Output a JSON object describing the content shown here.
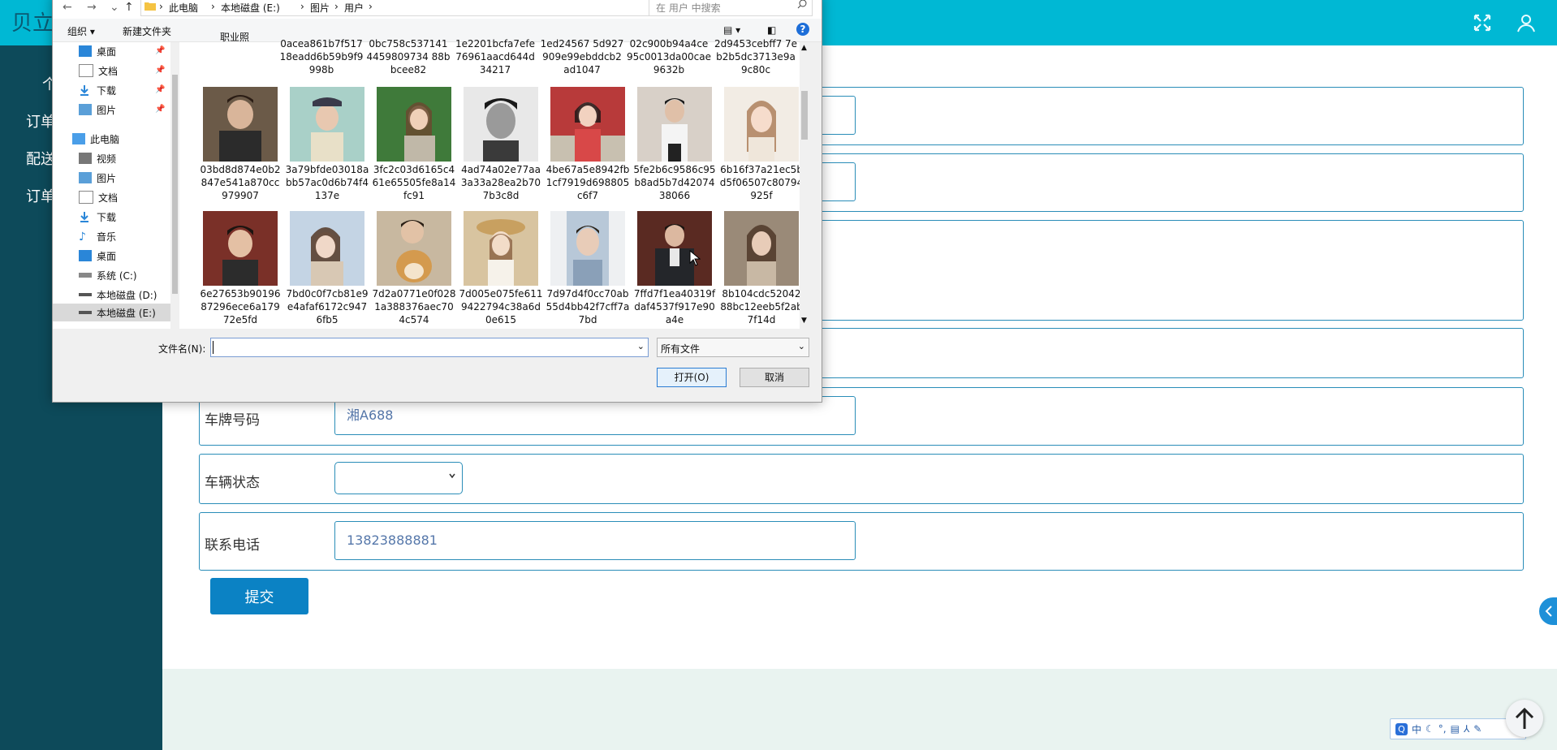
{
  "app": {
    "brand": "贝立",
    "sidebar": [
      "个",
      "订单",
      "配送",
      "订单"
    ]
  },
  "form": {
    "plate_label": "车牌号码",
    "plate_value": "湘A688",
    "status_label": "车辆状态",
    "status_value": "",
    "phone_label": "联系电话",
    "phone_value": "13823888881",
    "submit_label": "提交"
  },
  "ime": {
    "logo": "Q",
    "mode": "中",
    "extras": [
      "☾",
      "°,",
      "▤",
      "⅄",
      "✎"
    ]
  },
  "dialog": {
    "breadcrumbs": [
      "此电脑",
      "本地磁盘 (E:)",
      "图片",
      "用户"
    ],
    "search_placeholder": "在 用户 中搜索",
    "toolbar": {
      "organize": "组织",
      "new_folder": "新建文件夹"
    },
    "nav_items": [
      {
        "label": "桌面",
        "icon": "desktop-icon",
        "pinned": true
      },
      {
        "label": "文档",
        "icon": "document-icon",
        "pinned": true
      },
      {
        "label": "下载",
        "icon": "download-icon",
        "pinned": true
      },
      {
        "label": "图片",
        "icon": "picture-icon",
        "pinned": true
      },
      {
        "label": "此电脑",
        "icon": "computer-icon",
        "pinned": false
      },
      {
        "label": "视频",
        "icon": "video-icon",
        "pinned": false
      },
      {
        "label": "图片",
        "icon": "picture-icon",
        "pinned": false
      },
      {
        "label": "文档",
        "icon": "document-icon",
        "pinned": false
      },
      {
        "label": "下载",
        "icon": "download-icon",
        "pinned": false
      },
      {
        "label": "音乐",
        "icon": "music-icon",
        "pinned": false
      },
      {
        "label": "桌面",
        "icon": "desktop-icon",
        "pinned": false
      },
      {
        "label": "系统 (C:)",
        "icon": "drive-c-icon",
        "pinned": false
      },
      {
        "label": "本地磁盘 (D:)",
        "icon": "drive-icon",
        "pinned": false
      },
      {
        "label": "本地磁盘 (E:)",
        "icon": "drive-icon",
        "pinned": false,
        "selected": true
      }
    ],
    "files_top_partial": [
      "职业照",
      "0acea861b7f51718eadd6b59b9f9998b",
      "0bc758c5371414459809734 88bbcee82",
      "1e2201bcfa7efe76961aacd644d34217",
      "1ed24567 5d927909e99ebddcb2ad1047",
      "02c900b94a4ce95c0013da00cae9632b",
      "2d9453cebff7 7eb2b5dc3713e9a9c80c"
    ],
    "files_row1": [
      "03bd8d874e0b2847e541a870cc979907",
      "3a79bfde03018abb57ac0d6b74f4137e",
      "3fc2c03d6165c461e65505fe8a14fc91",
      "4ad74a02e77aa3a33a28ea2b707b3c8d",
      "4be67a5e8942fb1cf7919d698805c6f7",
      "5fe2b6c9586c95b8ad5b7d4207438066",
      "6b16f37a21ec5bd5f06507c80794925f"
    ],
    "files_row2": [
      "6e27653b9019687296ece6a17972e5fd",
      "7bd0c0f7cb81e9e4afaf6172c9476fb5",
      "7d2a0771e0f0281a388376aec704c574",
      "7d005e075fe6119422794c38a6d0e615",
      "7d97d4f0cc70ab55d4bb42f7cff7a7bd",
      "7ffd7f1ea40319fdaf4537f917e90a4e",
      "8b104cdc5204288bc12eeb5f2ab7f14d"
    ],
    "filename_label": "文件名(N):",
    "filename_value": "",
    "filetype": "所有文件",
    "open_label": "打开(O)",
    "cancel_label": "取消"
  }
}
